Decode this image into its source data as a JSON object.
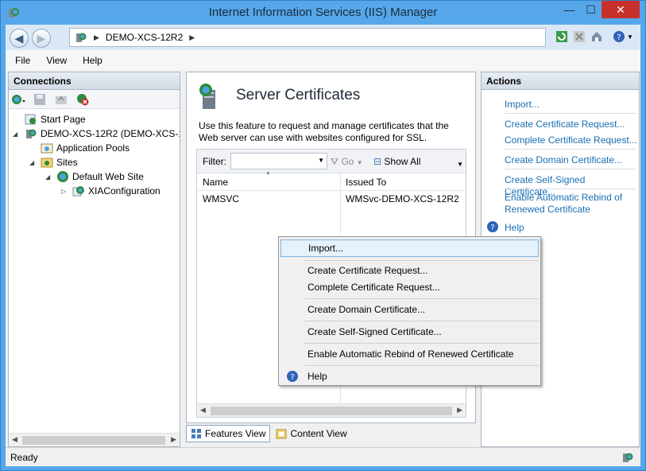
{
  "window": {
    "title": "Internet Information Services (IIS) Manager",
    "controls": {
      "minimize": "—",
      "maximize": "☐",
      "close": "✕"
    }
  },
  "address": {
    "crumb": "DEMO-XCS-12R2",
    "separator": "▶"
  },
  "menu": {
    "file": "File",
    "view": "View",
    "help": "Help"
  },
  "connections": {
    "title": "Connections",
    "tree": {
      "start_page": "Start Page",
      "server": "DEMO-XCS-12R2 (DEMO-XCS-12",
      "app_pools": "Application Pools",
      "sites": "Sites",
      "default_site": "Default Web Site",
      "xia": "XIAConfiguration"
    }
  },
  "feature": {
    "title": "Server Certificates",
    "description": "Use this feature to request and manage certificates that the Web server can use with websites configured for SSL.",
    "filter_label": "Filter:",
    "go_label": "Go",
    "show_all_label": "Show All",
    "columns": {
      "name": "Name",
      "issued_to": "Issued To"
    },
    "rows": [
      {
        "name": "WMSVC",
        "issued_to": "WMSvc-DEMO-XCS-12R2"
      }
    ]
  },
  "view_tabs": {
    "features": "Features View",
    "content": "Content View"
  },
  "actions": {
    "title": "Actions",
    "import": "Import...",
    "create_request": "Create Certificate Request...",
    "complete_request": "Complete Certificate Request...",
    "create_domain": "Create Domain Certificate...",
    "create_self_signed": "Create Self-Signed Certificate...",
    "enable_rebind": "Enable Automatic Rebind of Renewed Certificate",
    "help": "Help"
  },
  "context_menu": {
    "import": "Import...",
    "create_request": "Create Certificate Request...",
    "complete_request": "Complete Certificate Request...",
    "create_domain": "Create Domain Certificate...",
    "create_self_signed": "Create Self-Signed Certificate...",
    "enable_rebind": "Enable Automatic Rebind of Renewed Certificate",
    "help": "Help"
  },
  "status": {
    "text": "Ready"
  },
  "colors": {
    "link": "#1a6fb3",
    "window_frame": "#56a7ea",
    "close_button": "#c7312b"
  }
}
